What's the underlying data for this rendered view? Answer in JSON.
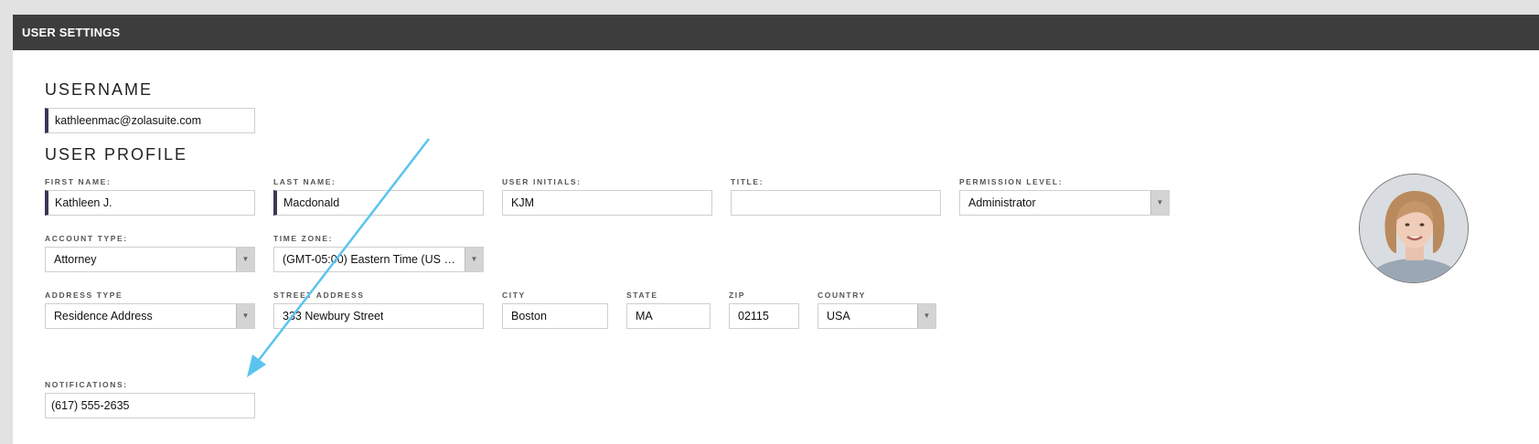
{
  "header": {
    "title": "USER SETTINGS"
  },
  "username": {
    "section_title": "USERNAME",
    "value": "kathleenmac@zolasuite.com"
  },
  "profile": {
    "section_title": "USER PROFILE",
    "first_name": {
      "label": "FIRST NAME:",
      "value": "Kathleen J."
    },
    "last_name": {
      "label": "LAST NAME:",
      "value": "Macdonald"
    },
    "initials": {
      "label": "USER INITIALS:",
      "value": "KJM"
    },
    "title": {
      "label": "TITLE:",
      "value": ""
    },
    "permission": {
      "label": "PERMISSION LEVEL:",
      "value": "Administrator"
    },
    "account_type": {
      "label": "ACCOUNT TYPE:",
      "value": "Attorney"
    },
    "time_zone": {
      "label": "TIME ZONE:",
      "value": "(GMT-05:00) Eastern Time (US and …"
    },
    "address_type": {
      "label": "ADDRESS TYPE",
      "value": "Residence Address"
    },
    "street": {
      "label": "STREET ADDRESS",
      "value": "333 Newbury Street"
    },
    "city": {
      "label": "CITY",
      "value": "Boston"
    },
    "state": {
      "label": "STATE",
      "value": "MA"
    },
    "zip": {
      "label": "ZIP",
      "value": "02115"
    },
    "country": {
      "label": "COUNTRY",
      "value": "USA"
    },
    "notifications": {
      "label": "NOTIFICATIONS:",
      "value": "(617) 555-2635"
    }
  },
  "colors": {
    "header_bg": "#3d3d3d",
    "required_marker": "#3b3757",
    "annotation_arrow": "#5ac4ef"
  },
  "icons": {
    "dropdown": "chevron-down-icon",
    "avatar": "user-photo"
  }
}
